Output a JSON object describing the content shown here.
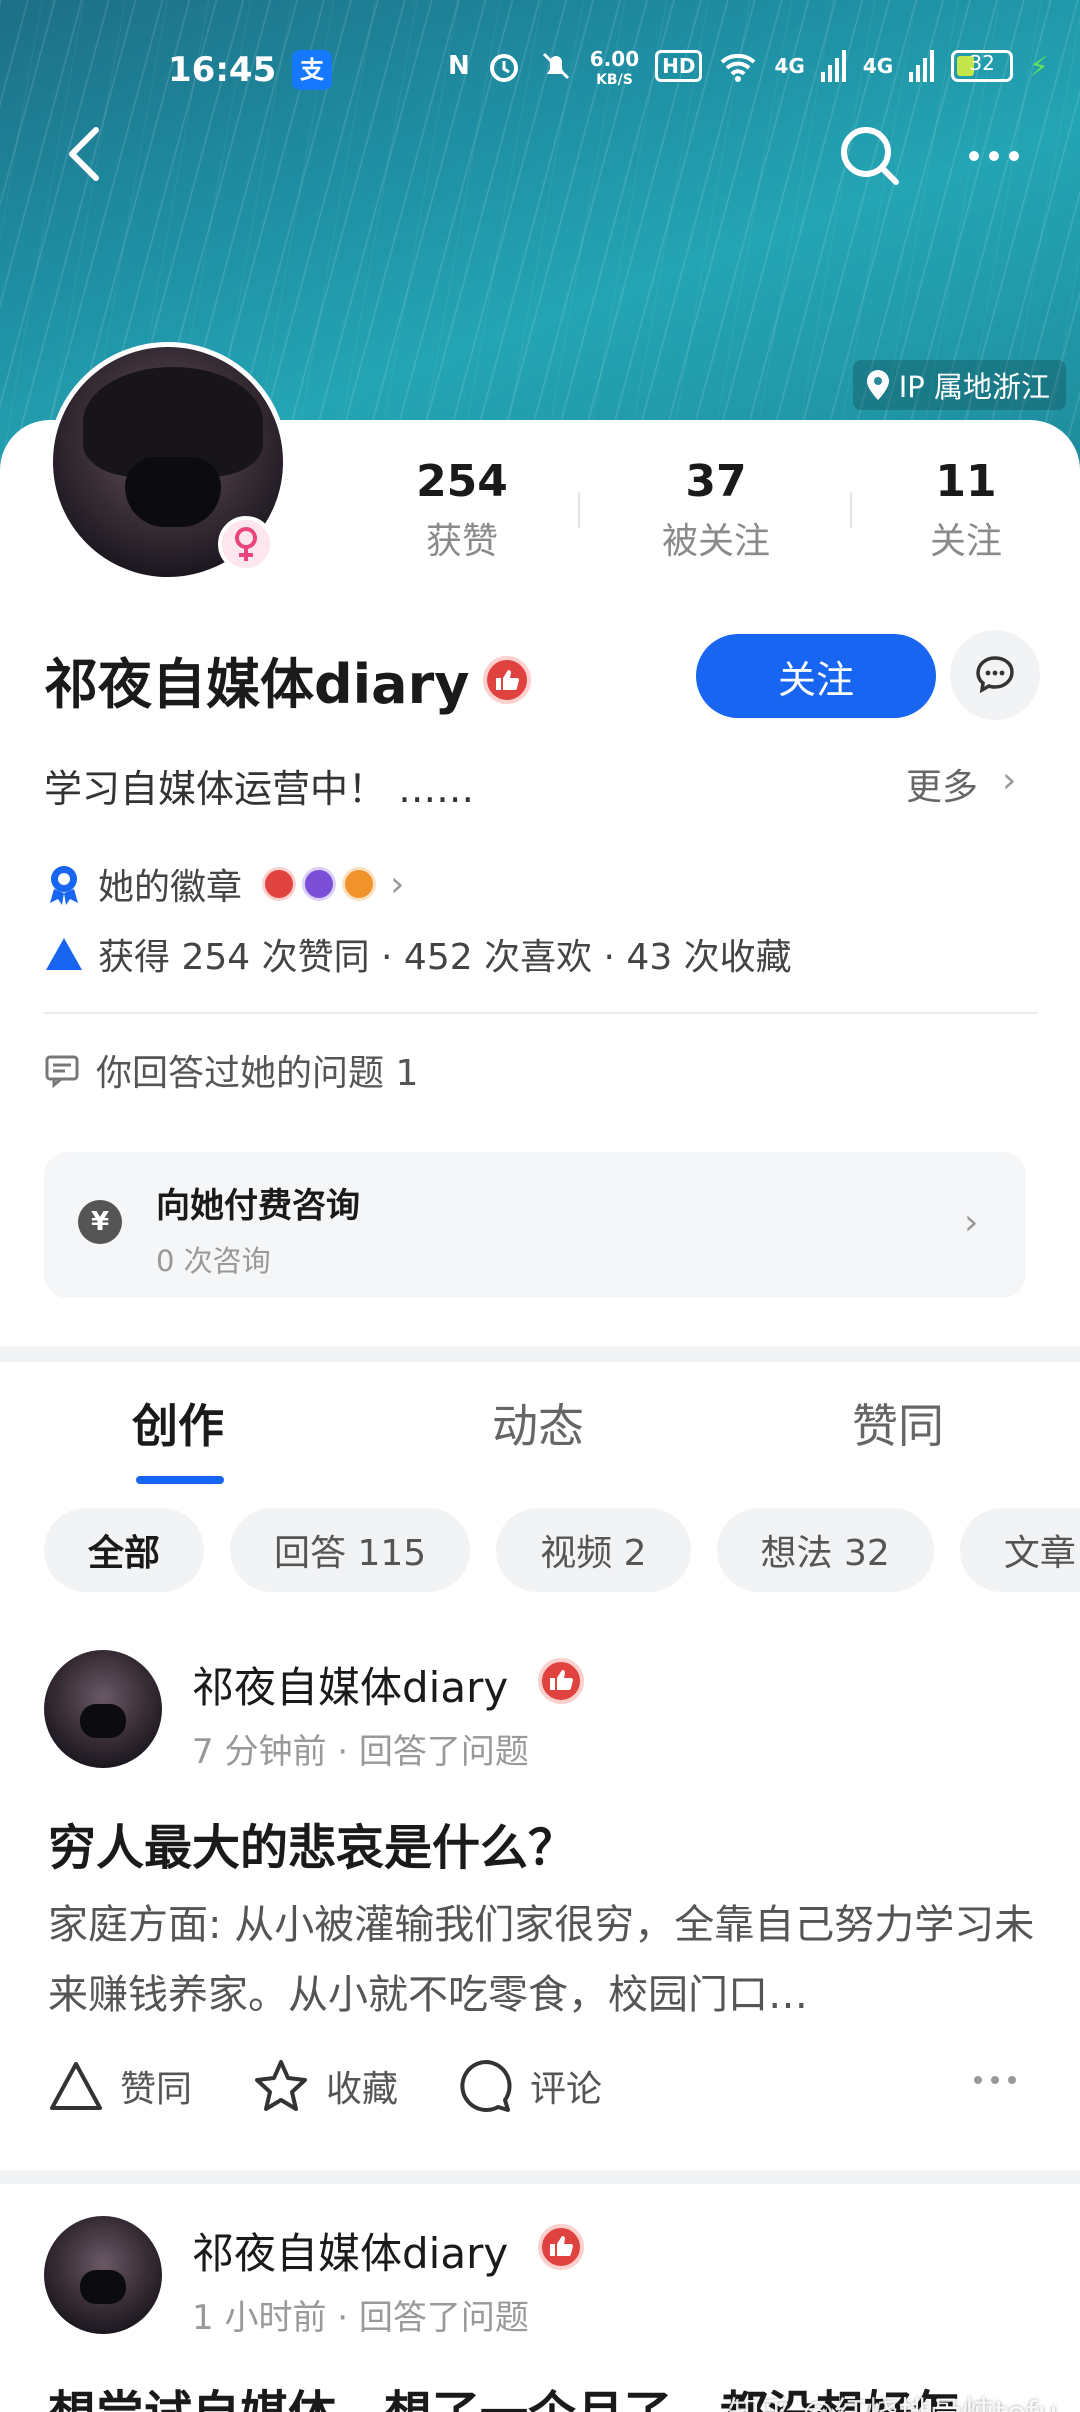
{
  "status_bar": {
    "time": "16:45",
    "alipay_icon": "支",
    "nfc_icon": "N",
    "network_speed": "6.00",
    "network_speed_unit": "KB/S",
    "hd_label": "HD",
    "signal1": "4G",
    "signal2": "4G",
    "battery": "32"
  },
  "header": {
    "ip_location": "IP 属地浙江"
  },
  "profile": {
    "stats": [
      {
        "num": "254",
        "label": "获赞"
      },
      {
        "num": "37",
        "label": "被关注"
      },
      {
        "num": "11",
        "label": "关注"
      }
    ],
    "username": "祁夜自媒体diary",
    "follow_label": "关注",
    "bio": "学习自媒体运营中！ ……",
    "more_label": "更多",
    "badges_label": "她的徽章",
    "stats_summary": "获得 254 次赞同 · 452 次喜欢 · 43 次收藏",
    "answered_label": "你回答过她的问题 1",
    "consult_title": "向她付费咨询",
    "consult_sub": "0 次咨询",
    "consult_icon": "¥"
  },
  "tabs": [
    "创作",
    "动态",
    "赞同"
  ],
  "filters": [
    "全部",
    "回答 115",
    "视频 2",
    "想法 32",
    "文章"
  ],
  "posts": [
    {
      "author": "祁夜自媒体diary",
      "meta": "7 分钟前 · 回答了问题",
      "title": "穷人最大的悲哀是什么？",
      "excerpt": "家庭方面: 从小被灌输我们家很穷，全靠自己努力学习未来赚钱养家。从小就不吃零食，校园门口…"
    },
    {
      "author": "祁夜自媒体diary",
      "meta": "1 小时前 · 回答了问题",
      "title": "想尝试自媒体，想了一个月了，都没想好怎"
    }
  ],
  "actions": {
    "like": "赞同",
    "fav": "收藏",
    "comment": "评论"
  },
  "watermark": "知乎 @红烧排骨炖tofu",
  "colors": {
    "accent": "#1765f0",
    "banner": "#1f8fa3",
    "like_badge": "#e0433f"
  }
}
